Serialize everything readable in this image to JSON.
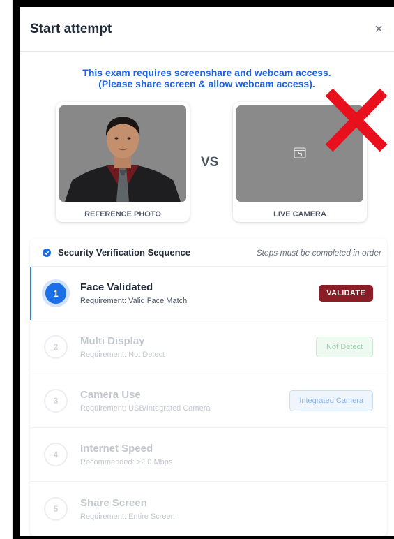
{
  "modal": {
    "title": "Start attempt",
    "close_glyph": "×"
  },
  "notice": {
    "line1": "This exam requires screenshare and webcam access.",
    "line2": "(Please share screen & allow webcam access)."
  },
  "photos": {
    "reference_label": "REFERENCE PHOTO",
    "vs_label": "VS",
    "live_label": "LIVE CAMERA",
    "live_icon": "camera-blocked-icon",
    "overlay_icon": "red-x-icon"
  },
  "sequence": {
    "title": "Security Verification Sequence",
    "note": "Steps must be completed in order",
    "steps": [
      {
        "num": "1",
        "title": "Face Validated",
        "req": "Requirement: Valid Face Match",
        "action": "VALIDATE"
      },
      {
        "num": "2",
        "title": "Multi Display",
        "req": "Requirement: Not Detect",
        "action": "Not Detect"
      },
      {
        "num": "3",
        "title": "Camera Use",
        "req": "Requirement: USB/Integrated Camera",
        "action": "Integrated Camera"
      },
      {
        "num": "4",
        "title": "Internet Speed",
        "req": "Recommended: >2.0 Mbps"
      },
      {
        "num": "5",
        "title": "Share Screen",
        "req": "Requirement: Entire Screen"
      }
    ]
  },
  "colors": {
    "accent": "#1a6fe6",
    "validate": "#8b1d26",
    "notice": "#1d64e2",
    "overlay_x": "#e8101c"
  }
}
